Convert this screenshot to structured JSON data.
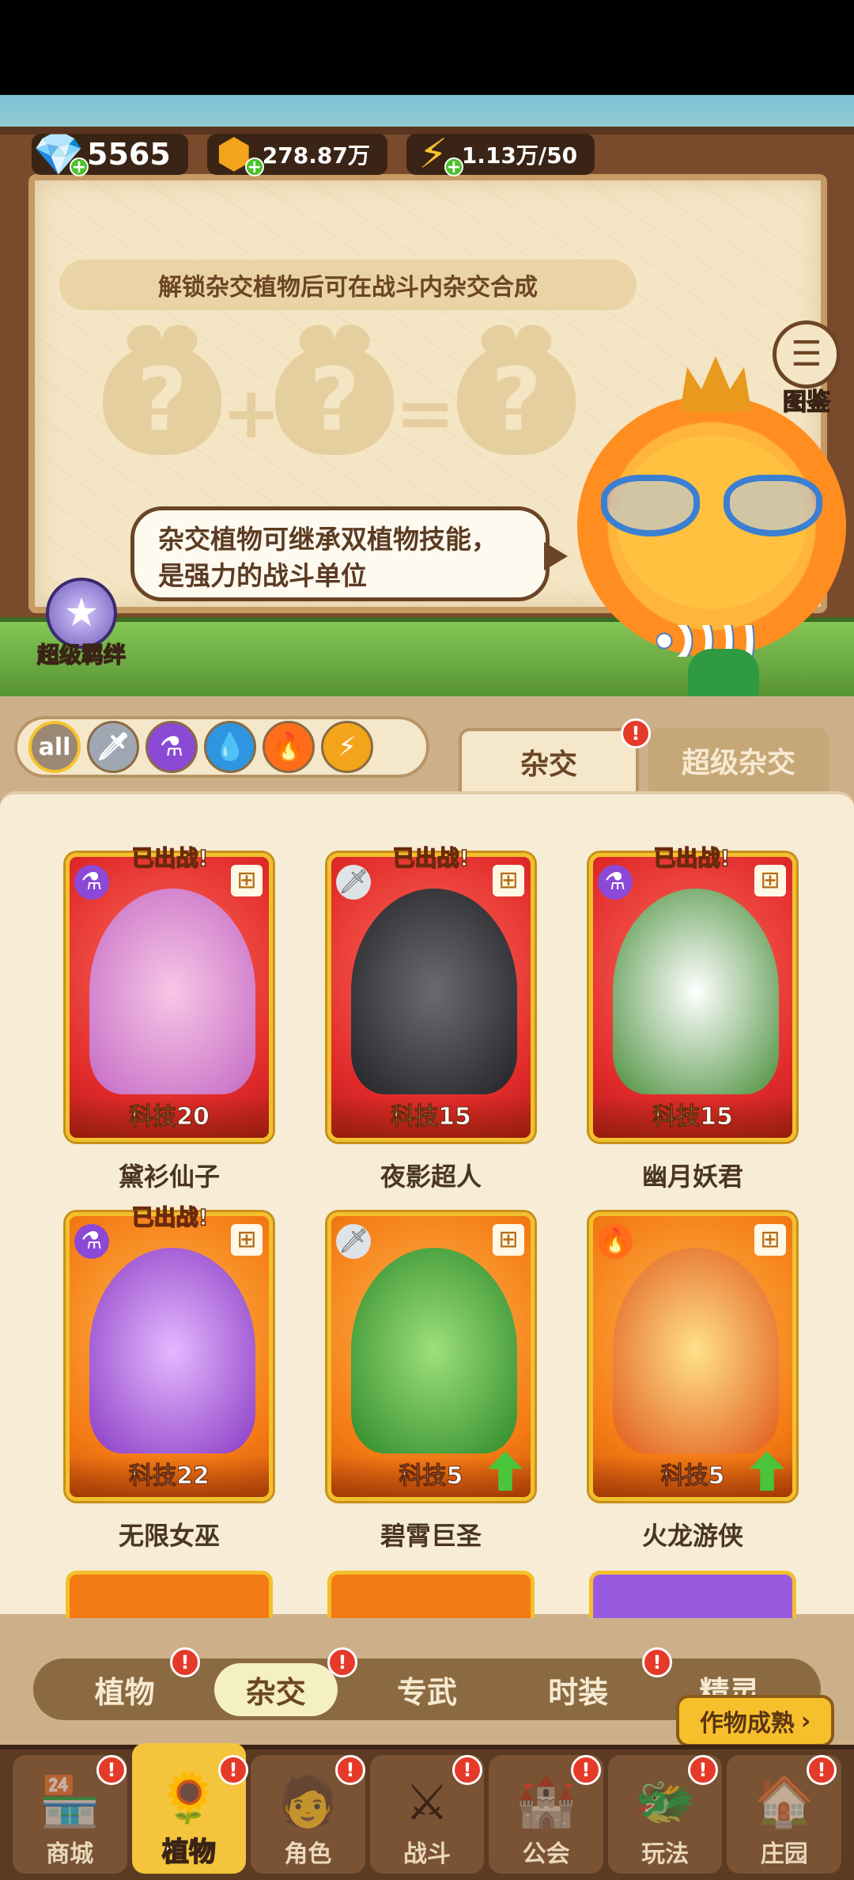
{
  "currency": {
    "gems": "5565",
    "coins": "278.87万",
    "energy": "1.13万/50"
  },
  "hybrid": {
    "unlock_hint": "解锁杂交植物后可在战斗内杂交合成",
    "speech": "杂交植物可继承双植物技能，是强力的战斗单位",
    "atlas_label": "图鉴",
    "bond_label": "超级羁绊"
  },
  "filters": {
    "all_label": "all",
    "icons": [
      "sword-icon",
      "potion-icon",
      "water-drop-icon",
      "fire-icon",
      "lightning-icon"
    ]
  },
  "tabs": {
    "hybrid": "杂交",
    "super_hybrid": "超级杂交",
    "badge": "!"
  },
  "deployed_label": "已出战!",
  "cards": [
    {
      "name": "黛衫仙子",
      "tech": "科技20",
      "deployed": true,
      "element": "potion"
    },
    {
      "name": "夜影超人",
      "tech": "科技15",
      "deployed": true,
      "element": "sword"
    },
    {
      "name": "幽月妖君",
      "tech": "科技15",
      "deployed": true,
      "element": "potion"
    },
    {
      "name": "无限女巫",
      "tech": "科技22",
      "deployed": true,
      "element": "potion"
    },
    {
      "name": "碧霄巨圣",
      "tech": "科技5",
      "deployed": false,
      "element": "sword"
    },
    {
      "name": "火龙游侠",
      "tech": "科技5",
      "deployed": false,
      "element": "fire"
    }
  ],
  "categories": [
    "植物",
    "杂交",
    "专武",
    "时装",
    "精灵"
  ],
  "harvest_button": "作物成熟",
  "nav": [
    "商城",
    "植物",
    "角色",
    "战斗",
    "公会",
    "玩法",
    "庄园"
  ],
  "colors": {
    "accent": "#f4c43c",
    "badge": "#e53a2a",
    "wood": "#5b3b22"
  }
}
